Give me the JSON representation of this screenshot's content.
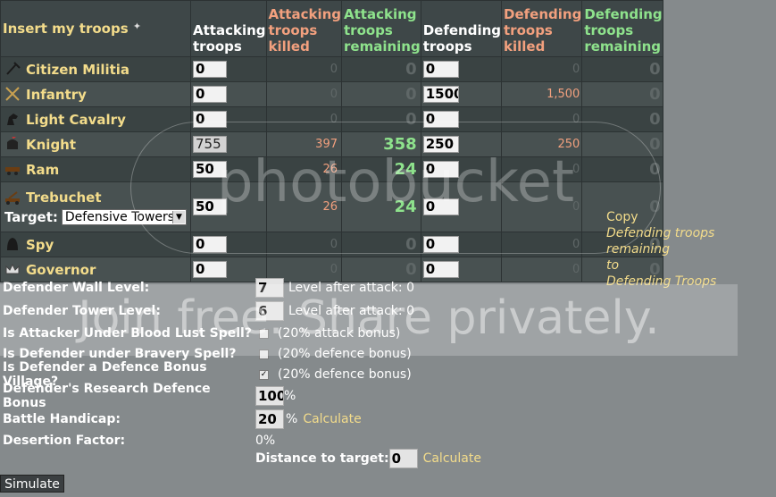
{
  "header": {
    "insert_label": "Insert my troops",
    "attacking_troops": "Attacking troops",
    "attacking_killed": "Attacking troops killed",
    "attacking_remaining": "Attacking troops remaining",
    "defending_troops": "Defending troops",
    "defending_killed": "Defending troops killed",
    "defending_remaining": "Defending troops remaining"
  },
  "troops": [
    {
      "name": "Citizen Militia",
      "icon": "pitchfork-icon",
      "att": "0",
      "att_killed": "0",
      "att_remain": "0",
      "def": "0",
      "def_killed": "0",
      "def_remain": "0"
    },
    {
      "name": "Infantry",
      "icon": "crossed-swords-icon",
      "att": "0",
      "att_killed": "0",
      "att_remain": "0",
      "def": "1500",
      "def_killed": "1,500",
      "def_remain": "0"
    },
    {
      "name": "Light Cavalry",
      "icon": "horse-head-icon",
      "att": "0",
      "att_killed": "0",
      "att_remain": "0",
      "def": "0",
      "def_killed": "0",
      "def_remain": "0"
    },
    {
      "name": "Knight",
      "icon": "helmet-icon",
      "att": "755",
      "att_killed": "397",
      "att_remain": "358",
      "def": "250",
      "def_killed": "250",
      "def_remain": "0"
    },
    {
      "name": "Ram",
      "icon": "ram-icon",
      "att": "50",
      "att_killed": "26",
      "att_remain": "24",
      "def": "0",
      "def_killed": "0",
      "def_remain": "0"
    },
    {
      "name": "Trebuchet",
      "icon": "trebuchet-icon",
      "att": "50",
      "att_killed": "26",
      "att_remain": "24",
      "def": "0",
      "def_killed": "0",
      "def_remain": "0"
    },
    {
      "name": "Spy",
      "icon": "hood-icon",
      "att": "0",
      "att_killed": "0",
      "att_remain": "0",
      "def": "0",
      "def_killed": "0",
      "def_remain": "0"
    },
    {
      "name": "Governor",
      "icon": "crown-icon",
      "att": "0",
      "att_killed": "0",
      "att_remain": "0",
      "def": "0",
      "def_killed": "0",
      "def_remain": "0"
    }
  ],
  "target": {
    "label": "Target:",
    "selected": "Defensive Towers"
  },
  "copy": {
    "line1": "Copy",
    "line2": "Defending troops remaining",
    "line3": "to",
    "line4": "Defending Troops"
  },
  "form": {
    "wall_label": "Defender Wall Level:",
    "wall_value": "7",
    "wall_after": "Level after attack: 0",
    "tower_label": "Defender Tower Level:",
    "tower_value": "6",
    "tower_after": "Level after attack: 0",
    "bloodlust_label": "Is Attacker Under Blood Lust Spell?",
    "bloodlust_bonus": "(20% attack bonus)",
    "bravery_label": "Is Defender under Bravery Spell?",
    "bravery_bonus": "(20% defence bonus)",
    "village_label": "Is Defender a Defence Bonus Village?",
    "village_bonus": "(20% defence bonus)",
    "research_label": "Defender's Research Defence Bonus",
    "research_value": "100",
    "research_unit": "%",
    "handicap_label": "Battle Handicap:",
    "handicap_value": "20",
    "handicap_unit": "%",
    "handicap_calc": "Calculate",
    "desertion_label": "Desertion Factor:",
    "desertion_value": "0%",
    "distance_label": "Distance to target:",
    "distance_value": "0",
    "distance_calc": "Calculate"
  },
  "simulate_label": "Simulate",
  "watermark": {
    "logo": "photobucket",
    "banner": "Join free. Share privately."
  }
}
